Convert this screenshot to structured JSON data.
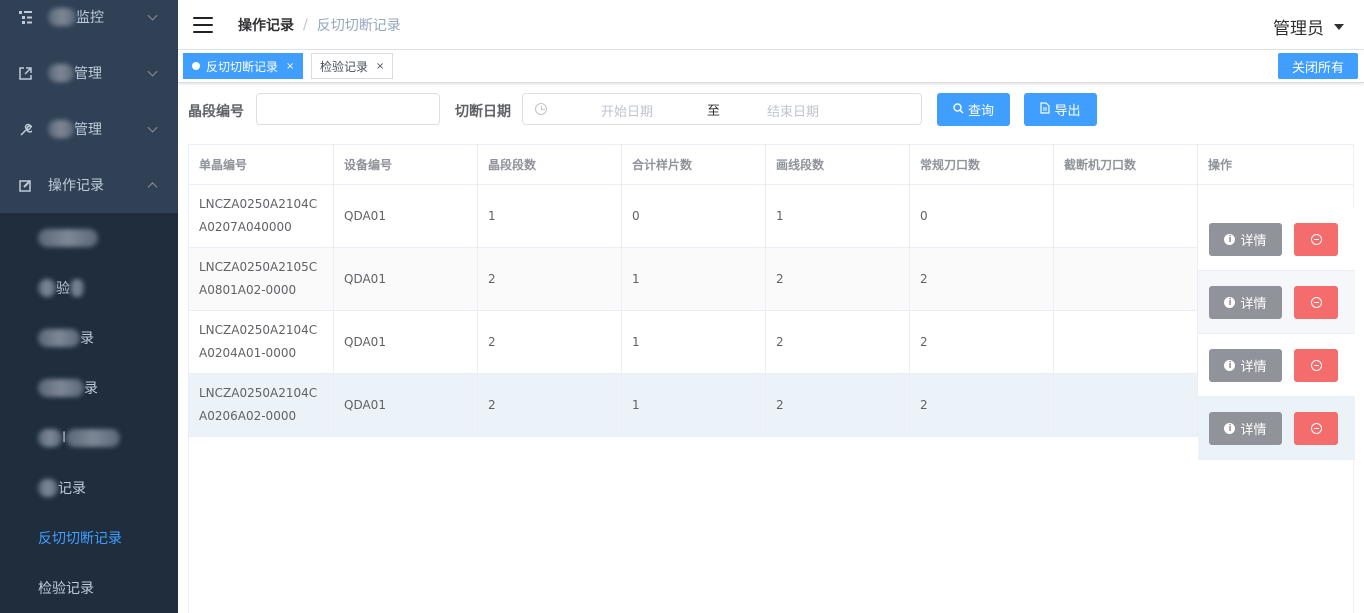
{
  "sidebar": {
    "items": [
      {
        "label": "监控",
        "icon": "list-tree-icon"
      },
      {
        "label": "管理",
        "icon": "external-link-icon"
      },
      {
        "label": "管理",
        "icon": "wrench-icon"
      },
      {
        "label": "操作记录",
        "icon": "edit-icon"
      }
    ],
    "sub_items": [
      {
        "label": ""
      },
      {
        "label": "验"
      },
      {
        "label": "录"
      },
      {
        "label": "录"
      },
      {
        "label": "I"
      },
      {
        "label": "记录"
      },
      {
        "label": "反切切断记录"
      },
      {
        "label": "检验记录"
      }
    ]
  },
  "navbar": {
    "breadcrumb_main": "操作记录",
    "breadcrumb_sep": "/",
    "breadcrumb_current": "反切切断记录",
    "user": "管理员"
  },
  "tags": {
    "items": [
      {
        "label": "反切切断记录",
        "close": "×"
      },
      {
        "label": "检验记录",
        "close": "×"
      }
    ],
    "close_all": "关闭所有"
  },
  "filter": {
    "segment_label": "晶段编号",
    "segment_value": "",
    "date_label": "切断日期",
    "start_placeholder": "开始日期",
    "range_sep": "至",
    "end_placeholder": "结束日期",
    "query_label": "查询",
    "export_label": "导出"
  },
  "table": {
    "headers": [
      "单晶编号",
      "设备编号",
      "晶段段数",
      "合计样片数",
      "画线段数",
      "常规刀口数",
      "截断机刀口数",
      "操作"
    ],
    "rows": [
      [
        "LNCZA0250A2104CA0207A040000",
        "QDA01",
        "1",
        "0",
        "1",
        "0",
        ""
      ],
      [
        "LNCZA0250A2105CA0801A02-0000",
        "QDA01",
        "2",
        "1",
        "2",
        "2",
        ""
      ],
      [
        "LNCZA0250A2104CA0204A01-0000",
        "QDA01",
        "2",
        "1",
        "2",
        "2",
        ""
      ],
      [
        "LNCZA0250A2104CA0206A02-0000",
        "QDA01",
        "2",
        "1",
        "2",
        "2",
        ""
      ]
    ],
    "detail_label": "详情",
    "info_glyph": "i"
  },
  "colors": {
    "sidebar_bg": "#304156",
    "submenu_bg": "#1f2d3d",
    "primary": "#409eff",
    "danger": "#f56c6c",
    "info": "#909399"
  }
}
